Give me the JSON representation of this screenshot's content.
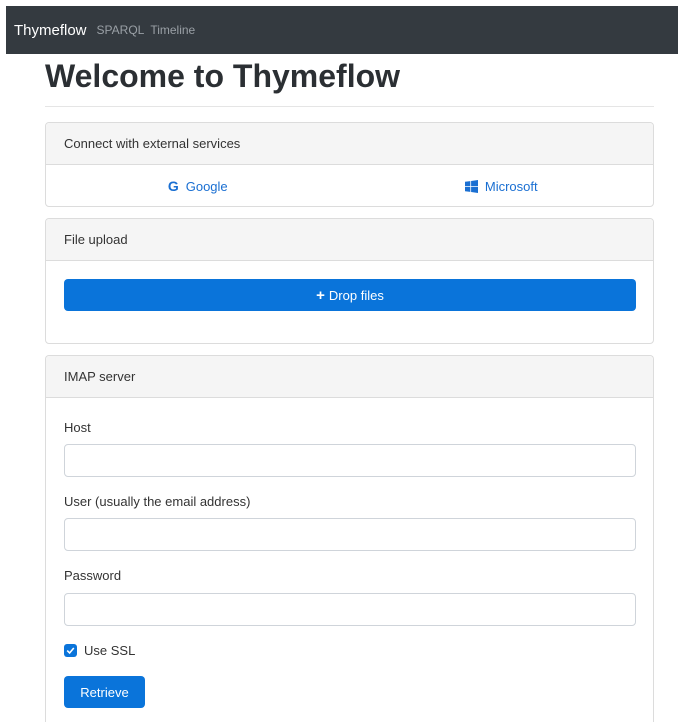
{
  "navbar": {
    "brand": "Thymeflow",
    "links": [
      "SPARQL",
      "Timeline"
    ]
  },
  "page": {
    "title": "Welcome to Thymeflow"
  },
  "connect_card": {
    "header": "Connect with external services",
    "services": [
      {
        "label": "Google",
        "icon": "google-icon"
      },
      {
        "label": "Microsoft",
        "icon": "windows-icon"
      }
    ]
  },
  "upload_card": {
    "header": "File upload",
    "button_label": "Drop files",
    "button_icon": "plus-icon"
  },
  "imap_card": {
    "header": "IMAP server",
    "host_label": "Host",
    "host_value": "",
    "user_label": "User (usually the email address)",
    "user_value": "",
    "password_label": "Password",
    "password_value": "",
    "ssl_label": "Use SSL",
    "ssl_checked": true,
    "retrieve_label": "Retrieve"
  },
  "colors": {
    "navbar_bg": "#343a40",
    "primary": "#0a74da",
    "link": "#1a6fd2"
  }
}
